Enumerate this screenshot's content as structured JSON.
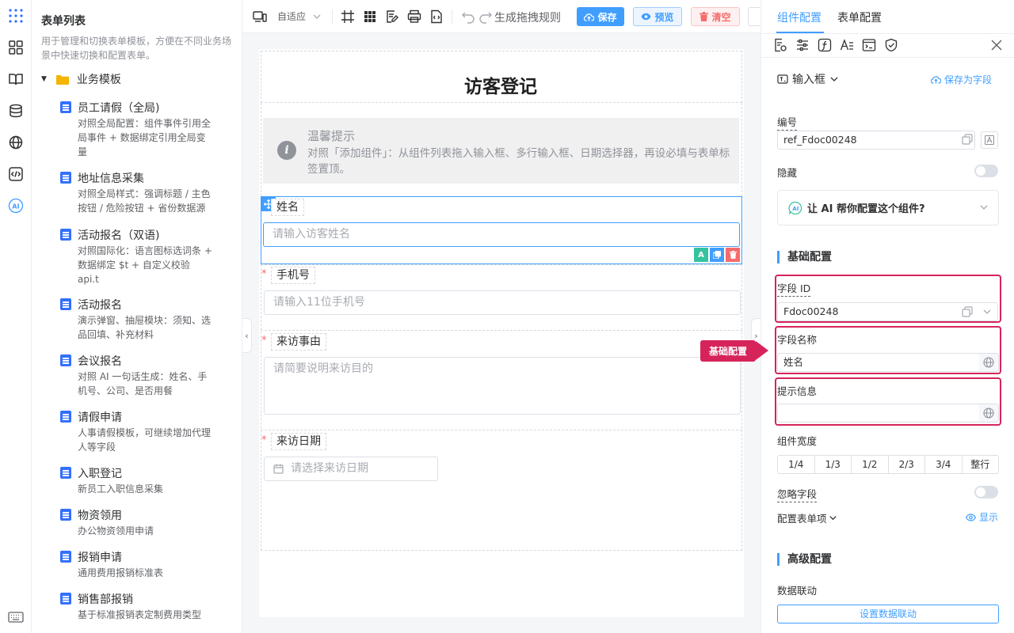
{
  "template_list": {
    "title": "表单列表",
    "description": "用于管理和切换表单模板，方便在不同业务场景中快速切换和配置表单。",
    "folder": "业务模板",
    "items": [
      {
        "name": "员工请假（全局)",
        "desc": "对照全局配置：组件事件引用全局事件 + 数据绑定引用全局变量"
      },
      {
        "name": "地址信息采集",
        "desc": "对照全局样式：强调标题 / 主色按钮 / 危险按钮 + 省份数据源"
      },
      {
        "name": "活动报名（双语)",
        "desc": "对照国际化：语言图标选词条 + 数据绑定 $t + 自定义校验 api.t"
      },
      {
        "name": "活动报名",
        "desc": "演示弹窗、抽屉模块：须知、选品回填、补充材料"
      },
      {
        "name": "会议报名",
        "desc": "对照 AI 一句话生成：姓名、手机号、公司、是否用餐"
      },
      {
        "name": "请假申请",
        "desc": "人事请假模板，可继续增加代理人等字段"
      },
      {
        "name": "入职登记",
        "desc": "新员工入职信息采集"
      },
      {
        "name": "物资领用",
        "desc": "办公物资领用申请"
      },
      {
        "name": "报销申请",
        "desc": "通用费用报销标准表"
      },
      {
        "name": "销售部报销",
        "desc": "基于标准报销表定制费用类型"
      }
    ]
  },
  "toolbar": {
    "layout_mode": "自适应",
    "rule_label": "生成拖拽规则",
    "save_label": "保存",
    "preview_label": "预览",
    "clear_label": "清空"
  },
  "form": {
    "title": "访客登记",
    "tip_title": "温馨提示",
    "tip_text": "对照「添加组件」：从组件列表拖入输入框、多行输入框、日期选择器，再设必填与表单标签置顶。",
    "fields": [
      {
        "label": "姓名",
        "placeholder": "请输入访客姓名"
      },
      {
        "label": "手机号",
        "placeholder": "请输入11位手机号"
      },
      {
        "label": "来访事由",
        "placeholder": "请简要说明来访目的"
      },
      {
        "label": "来访日期",
        "placeholder": "请选择来访日期"
      }
    ],
    "required_mark": "*",
    "ai_action": "A",
    "tip_icon": "i"
  },
  "props": {
    "tab_component": "组件配置",
    "tab_form": "表单配置",
    "component_type": "输入框",
    "save_as_field": "保存为字段",
    "ref_label": "编号",
    "ref_value": "ref_Fdoc00248",
    "hidden_label": "隐藏",
    "ai_prompt": "让 AI 帮你配置这个组件?",
    "basic_section": "基础配置",
    "field_id_label": "字段 ID",
    "field_id_value": "Fdoc00248",
    "field_name_label": "字段名称",
    "field_name_value": "姓名",
    "hint_label": "提示信息",
    "hint_value": "",
    "width_label": "组件宽度",
    "width_options": [
      "1/4",
      "1/3",
      "1/2",
      "2/3",
      "3/4",
      "整行"
    ],
    "ignore_label": "忽略字段",
    "form_item_label": "配置表单项",
    "show_link": "显示",
    "advanced_section": "高级配置",
    "linkage_label": "数据联动",
    "linkage_button": "设置数据联动"
  },
  "callout": "基础配置",
  "colors": {
    "accent": "#409eff",
    "highlight": "#d6245b",
    "danger": "#f56c6c"
  }
}
